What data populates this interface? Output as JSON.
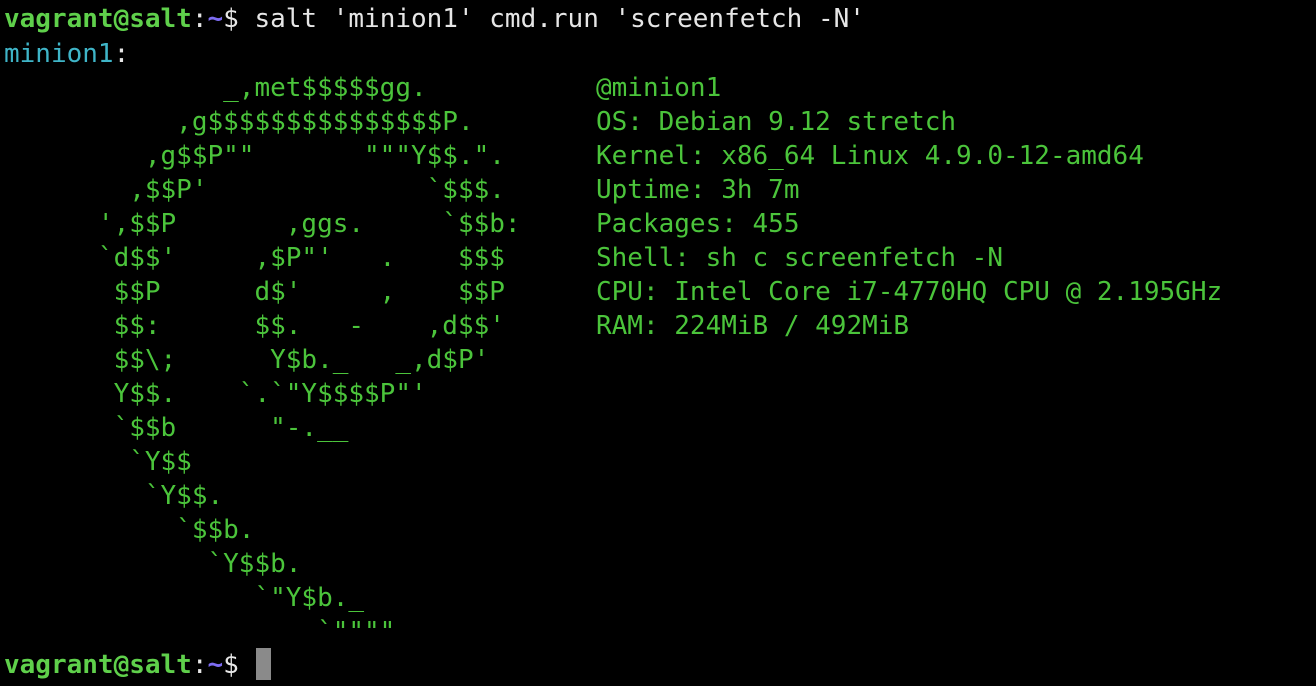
{
  "prompt1": {
    "user_host": "vagrant@salt",
    "colon": ":",
    "path": "~",
    "dollar": "$ ",
    "command": "salt 'minion1' cmd.run 'screenfetch -N'"
  },
  "minion_label": "minion1",
  "colon": ":",
  "ascii_art": [
    "              _,met$$$$$gg.",
    "           ,g$$$$$$$$$$$$$$$P.",
    "         ,g$$P\"\"       \"\"\"Y$$.\".",
    "        ,$$P'              `$$$.",
    "      ',$$P       ,ggs.     `$$b:",
    "      `d$$'     ,$P\"'   .    $$$",
    "       $$P      d$'     ,    $$P",
    "       $$:      $$.   -    ,d$$'",
    "       $$\\;      Y$b._   _,d$P'",
    "       Y$$.    `.`\"Y$$$$P\"'",
    "       `$$b      \"-.__",
    "        `Y$$",
    "         `Y$$.",
    "           `$$b.",
    "             `Y$$b.",
    "                `\"Y$b._",
    "                    `\"\"\"\""
  ],
  "system_info": [
    "@minion1",
    "OS: Debian 9.12 stretch",
    "Kernel: x86_64 Linux 4.9.0-12-amd64",
    "Uptime: 3h 7m",
    "Packages: 455",
    "Shell: sh c screenfetch -N",
    "CPU: Intel Core i7-4770HQ CPU @ 2.195GHz",
    "RAM: 224MiB / 492MiB"
  ],
  "prompt2": {
    "user_host": "vagrant@salt",
    "colon": ":",
    "path": "~",
    "dollar": "$ "
  },
  "colors": {
    "background": "#000000",
    "user_host": "#5fd04b",
    "path": "#7d6cf2",
    "minion_label": "#3fb5c8",
    "output_green": "#4bc43b",
    "cursor": "#8a8a8a"
  }
}
